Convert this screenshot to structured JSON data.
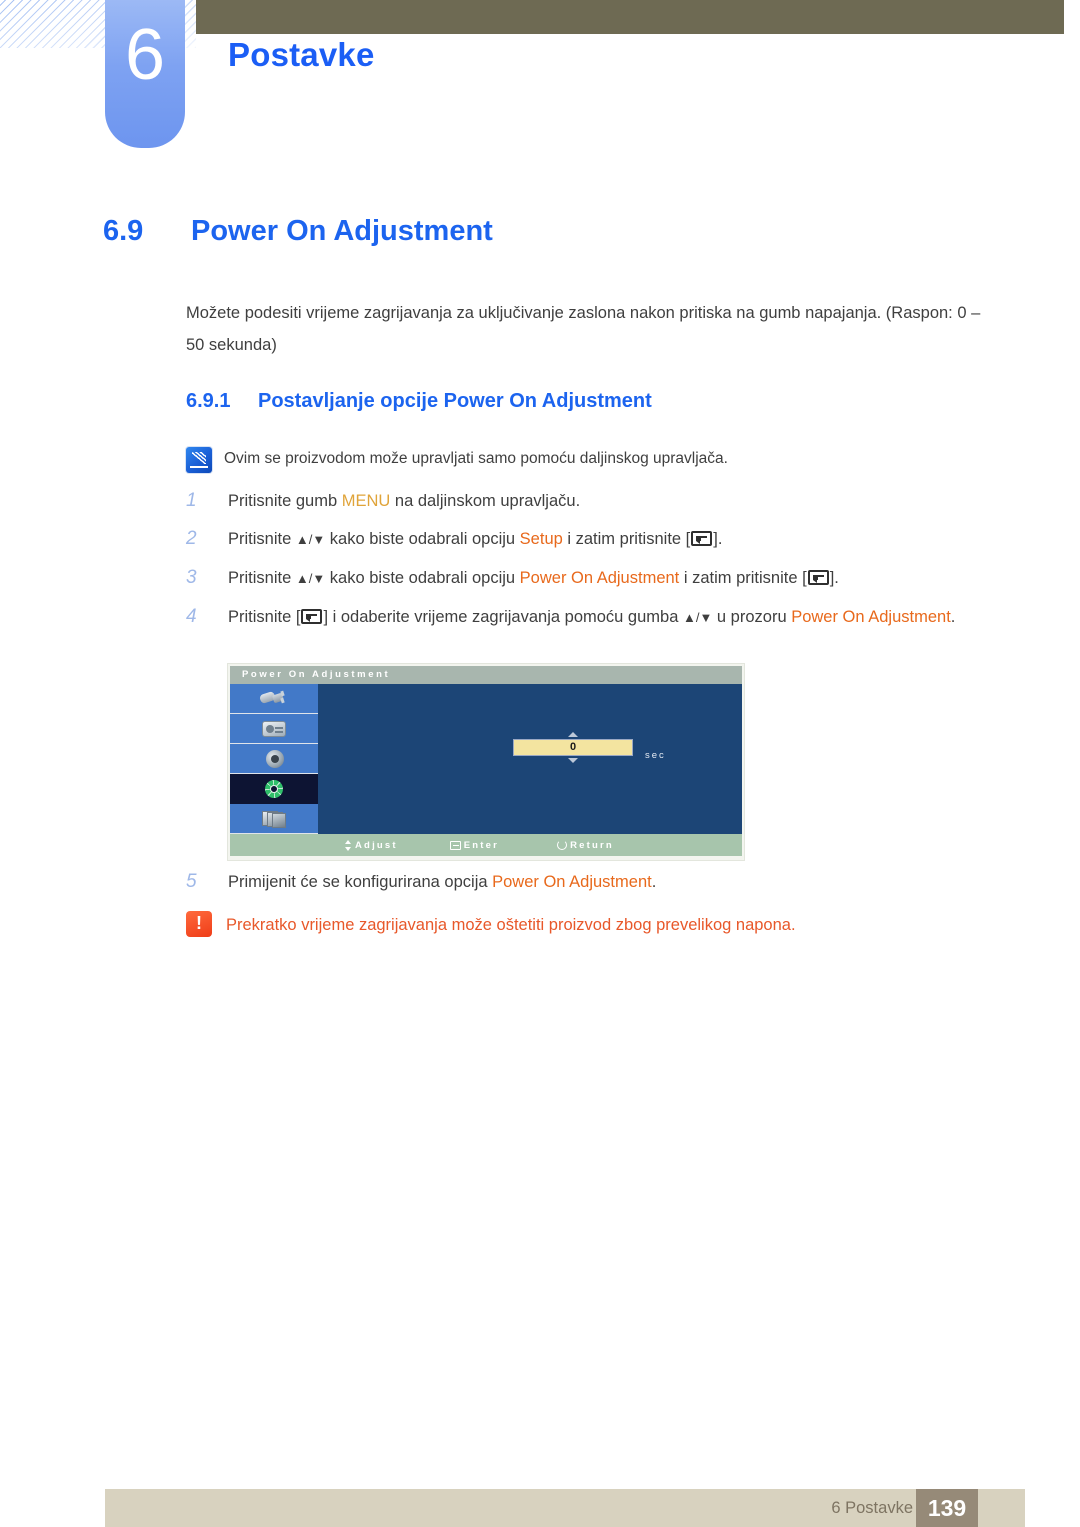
{
  "header": {
    "chapter_number": "6",
    "chapter_title": "Postavke"
  },
  "section": {
    "number": "6.9",
    "title": "Power On Adjustment",
    "intro": "Možete podesiti vrijeme zagrijavanja za uključivanje zaslona nakon pritiska na gumb napajanja. (Raspon: 0 – 50 sekunda)"
  },
  "subsection": {
    "number": "6.9.1",
    "title": "Postavljanje opcije Power On Adjustment"
  },
  "note": {
    "icon": "note-pencil-icon",
    "text": "Ovim se proizvodom može upravljati samo pomoću daljinskog upravljača."
  },
  "steps": [
    {
      "index": "1",
      "parts": [
        {
          "t": "Pritisnite gumb ",
          "style": "plain"
        },
        {
          "t": "MENU",
          "style": "tan"
        },
        {
          "t": " na daljinskom upravljaču.",
          "style": "plain"
        }
      ]
    },
    {
      "index": "2",
      "parts": [
        {
          "t": "Pritisnite ",
          "style": "plain"
        },
        {
          "t": "▲/▼",
          "style": "arrow"
        },
        {
          "t": " kako biste odabrali opciju ",
          "style": "plain"
        },
        {
          "t": "Setup",
          "style": "orange"
        },
        {
          "t": " i zatim pritisnite [",
          "style": "plain"
        },
        {
          "t": "",
          "style": "keyicon"
        },
        {
          "t": "].",
          "style": "plain"
        }
      ]
    },
    {
      "index": "3",
      "parts": [
        {
          "t": "Pritisnite ",
          "style": "plain"
        },
        {
          "t": "▲/▼",
          "style": "arrow"
        },
        {
          "t": " kako biste odabrali opciju ",
          "style": "plain"
        },
        {
          "t": "Power On Adjustment",
          "style": "orange"
        },
        {
          "t": " i zatim pritisnite [",
          "style": "plain"
        },
        {
          "t": "",
          "style": "keyicon"
        },
        {
          "t": "].",
          "style": "plain"
        }
      ]
    },
    {
      "index": "4",
      "parts": [
        {
          "t": "Pritisnite [",
          "style": "plain"
        },
        {
          "t": "",
          "style": "keyicon"
        },
        {
          "t": "] i odaberite vrijeme zagrijavanja pomoću gumba ",
          "style": "plain"
        },
        {
          "t": "▲/▼",
          "style": "arrow"
        },
        {
          "t": " u prozoru ",
          "style": "plain"
        },
        {
          "t": "Power On Adjustment",
          "style": "orange"
        },
        {
          "t": ".",
          "style": "plain"
        }
      ]
    }
  ],
  "osd": {
    "title": "Power On Adjustment",
    "sidebar_icons": [
      "plug-connector-icon",
      "picture-card-icon",
      "speaker-icon",
      "gear-setup-icon",
      "multi-display-stack-icon"
    ],
    "selected_index": 3,
    "value": "0",
    "unit": "sec",
    "spinner_up_icon": "triangle-up-icon",
    "spinner_down_icon": "triangle-down-icon",
    "footer": [
      {
        "icon": "up-down-arrow-icon",
        "label": "Adjust"
      },
      {
        "icon": "enter-key-icon",
        "label": "Enter"
      },
      {
        "icon": "return-circle-icon",
        "label": "Return"
      }
    ]
  },
  "step5": {
    "index": "5",
    "parts": [
      {
        "t": "Primijenit će se konfigurirana opcija ",
        "style": "plain"
      },
      {
        "t": "Power On Adjustment",
        "style": "orange"
      },
      {
        "t": ".",
        "style": "plain"
      }
    ]
  },
  "warning": {
    "icon": "exclamation-warning-icon",
    "glyph": "!",
    "text": "Prekratko vrijeme zagrijavanja može oštetiti proizvod zbog prevelikog napona."
  },
  "footer": {
    "label": "6 Postavke",
    "page": "139"
  },
  "colors": {
    "heading_blue": "#1c64ef",
    "chapter_blue": "#1b5ef5",
    "orange": "#e8691c",
    "tan": "#e0a43a",
    "warning_red": "#e8582a",
    "topbar_olive": "#6e6a53",
    "footer_tan": "#d8d2bf",
    "page_box": "#968a78",
    "osd_blue": "#1c4576",
    "osd_value_bg": "#f3e4a0"
  }
}
